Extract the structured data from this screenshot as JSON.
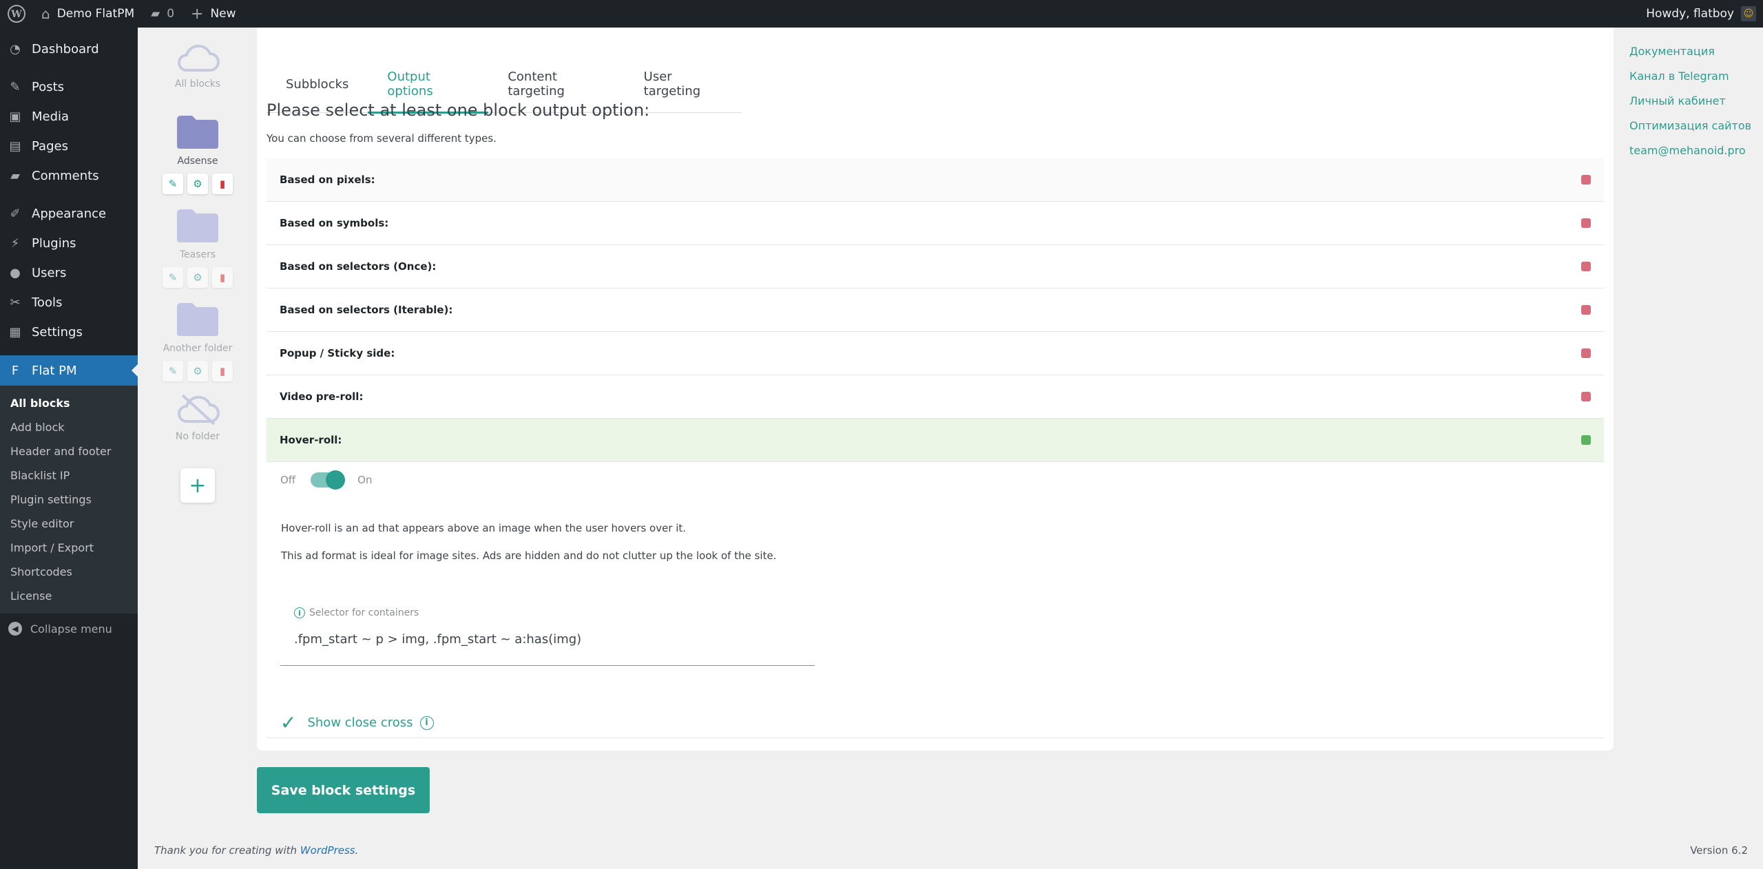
{
  "adminbar": {
    "site_name": "Demo FlatPM",
    "comments_count": "0",
    "new_label": "New",
    "howdy": "Howdy, flatboy"
  },
  "sidebar": {
    "items": [
      {
        "label": "Dashboard",
        "icon": "dashboard-icon"
      },
      {
        "label": "Posts",
        "icon": "pin-icon"
      },
      {
        "label": "Media",
        "icon": "media-icon"
      },
      {
        "label": "Pages",
        "icon": "pages-icon"
      },
      {
        "label": "Comments",
        "icon": "comments-icon"
      },
      {
        "label": "Appearance",
        "icon": "brush-icon"
      },
      {
        "label": "Plugins",
        "icon": "plugin-icon"
      },
      {
        "label": "Users",
        "icon": "user-icon"
      },
      {
        "label": "Tools",
        "icon": "wrench-icon"
      },
      {
        "label": "Settings",
        "icon": "settings-icon"
      },
      {
        "label": "Flat PM",
        "icon": "flatpm-icon"
      }
    ],
    "submenu": [
      "All blocks",
      "Add block",
      "Header and footer",
      "Blacklist IP",
      "Plugin settings",
      "Style editor",
      "Import / Export",
      "Shortcodes",
      "License"
    ],
    "collapse": "Collapse menu"
  },
  "folders": {
    "all_blocks": "All blocks",
    "adsense": "Adsense",
    "teasers": "Teasers",
    "another": "Another folder",
    "no_folder": "No folder"
  },
  "tabs": [
    "Subblocks",
    "Output options",
    "Content targeting",
    "User targeting"
  ],
  "main": {
    "heading": "Please select at least one block output option:",
    "subheading": "You can choose from several different types.",
    "options": [
      {
        "label": "Based on pixels:",
        "enabled": false
      },
      {
        "label": "Based on symbols:",
        "enabled": false
      },
      {
        "label": "Based on selectors (Once):",
        "enabled": false
      },
      {
        "label": "Based on selectors (Iterable):",
        "enabled": false
      },
      {
        "label": "Popup / Sticky side:",
        "enabled": false
      },
      {
        "label": "Video pre-roll:",
        "enabled": false
      },
      {
        "label": "Hover-roll:",
        "enabled": true
      }
    ],
    "toggle_off": "Off",
    "toggle_on": "On",
    "desc1": "Hover-roll is an ad that appears above an image when the user hovers over it.",
    "desc2": "This ad format is ideal for image sites. Ads are hidden and do not clutter up the look of the site.",
    "selector_label": "Selector for containers",
    "selector_value": ".fpm_start ~ p > img, .fpm_start ~ a:has(img)",
    "show_close": "Show close cross",
    "save": "Save block settings"
  },
  "links": [
    "Документация",
    "Канал в Telegram",
    "Личный кабинет",
    "Оптимизация сайтов",
    "team@mehanoid.pro"
  ],
  "footer": {
    "thanks": "Thank you for creating with ",
    "wp": "WordPress",
    "version": "Version 6.2"
  },
  "colors": {
    "accent": "#2a9d8f",
    "off_dot": "#d66c7c",
    "on_dot": "#5bb35f",
    "wp_blue": "#2271b1"
  }
}
